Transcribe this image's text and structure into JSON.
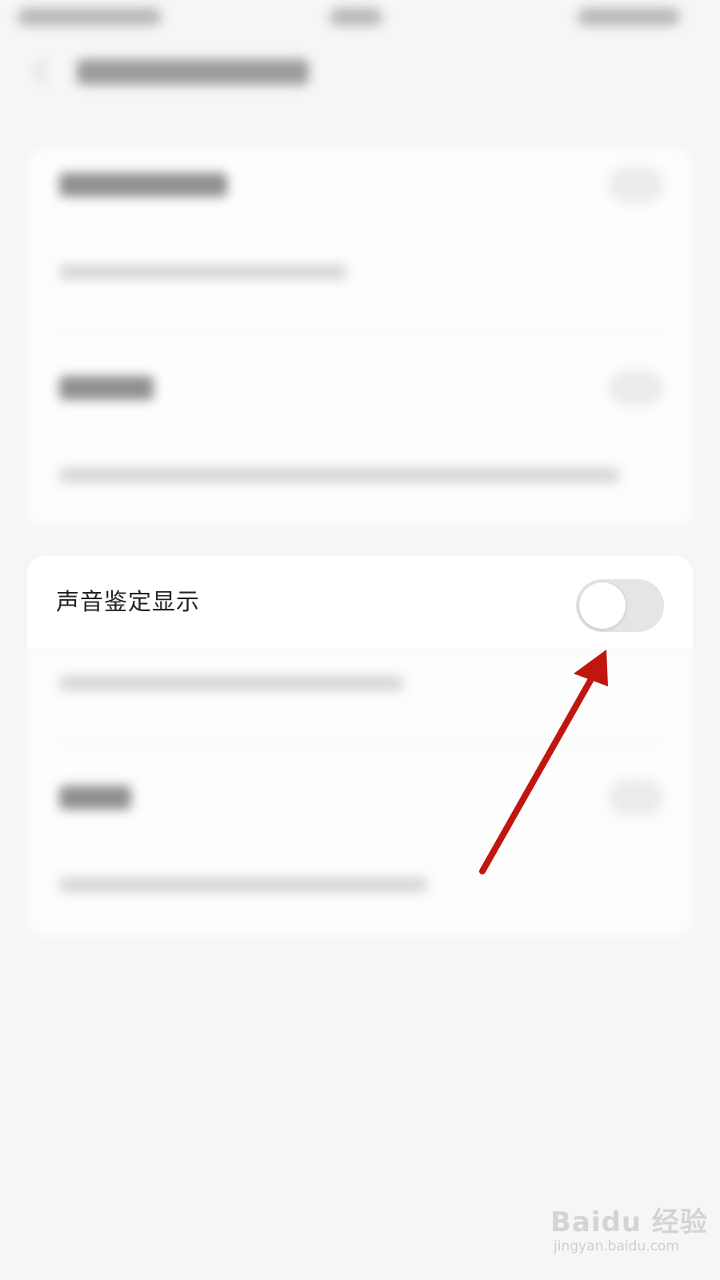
{
  "setting": {
    "label": "声音鉴定显示",
    "toggle_on": false
  },
  "colors": {
    "background": "#f6f6f6",
    "card": "#ffffff",
    "toggle_track_off": "#e5e5e7",
    "annotation_arrow": "#c0160f"
  },
  "annotation": {
    "icon": "arrow-icon"
  },
  "watermark": {
    "logo": "Baidu 经验",
    "url": "jingyan.baidu.com"
  }
}
